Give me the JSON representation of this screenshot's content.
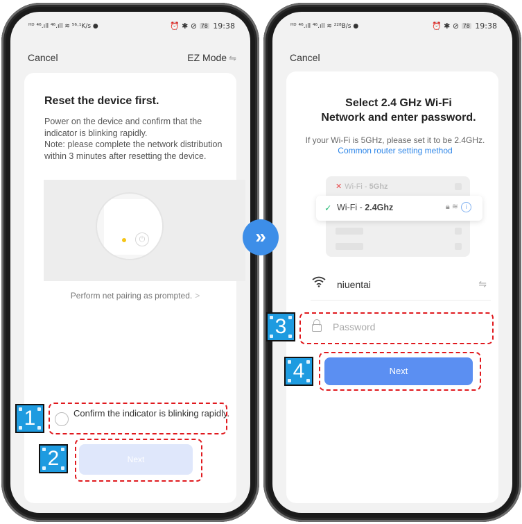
{
  "status_left": {
    "text": "ᴴᴰ ⁴⁶.ıll ⁴⁶.ıll ≋ ⁵⁶·¹K/s ●",
    "text_right": "ᴴᴰ ⁴⁶.ıll ⁴⁶.ıll ≋ ²²⁸B/s ●"
  },
  "status_right": {
    "icons": "⏰ ✱ ⊘",
    "battery": "78",
    "time": "19:38"
  },
  "left": {
    "cancel": "Cancel",
    "ez_mode": "EZ Mode",
    "title": "Reset the device first.",
    "desc": "Power on the device and confirm that the indicator is blinking rapidly.",
    "note": "Note: please complete the network distribution within 3 minutes after resetting the device.",
    "perform_link": "Perform net pairing as prompted.",
    "confirm_text": "Confirm the indicator is blinking rapidly.",
    "next": "Next"
  },
  "right": {
    "cancel": "Cancel",
    "title_line1": "Select 2.4 GHz Wi-Fi",
    "title_line2": "Network and enter password.",
    "sub_text": "If your Wi-Fi is 5GHz, please set it to be 2.4GHz.",
    "sub_link": "Common router setting method",
    "wifi_5g_prefix": "Wi-Fi - ",
    "wifi_5g_band": "5Ghz",
    "wifi_24_prefix": "Wi-Fi - ",
    "wifi_24_band": "2.4Ghz",
    "ssid": "niuentai",
    "password_placeholder": "Password",
    "next": "Next"
  },
  "annotations": {
    "step1": "1",
    "step2": "2",
    "step3": "3",
    "step4": "4"
  },
  "colors": {
    "accent": "#5b8ff2",
    "link": "#2e86e8",
    "annotation_red": "#e0191e",
    "badge_blue": "#1e9be0"
  }
}
